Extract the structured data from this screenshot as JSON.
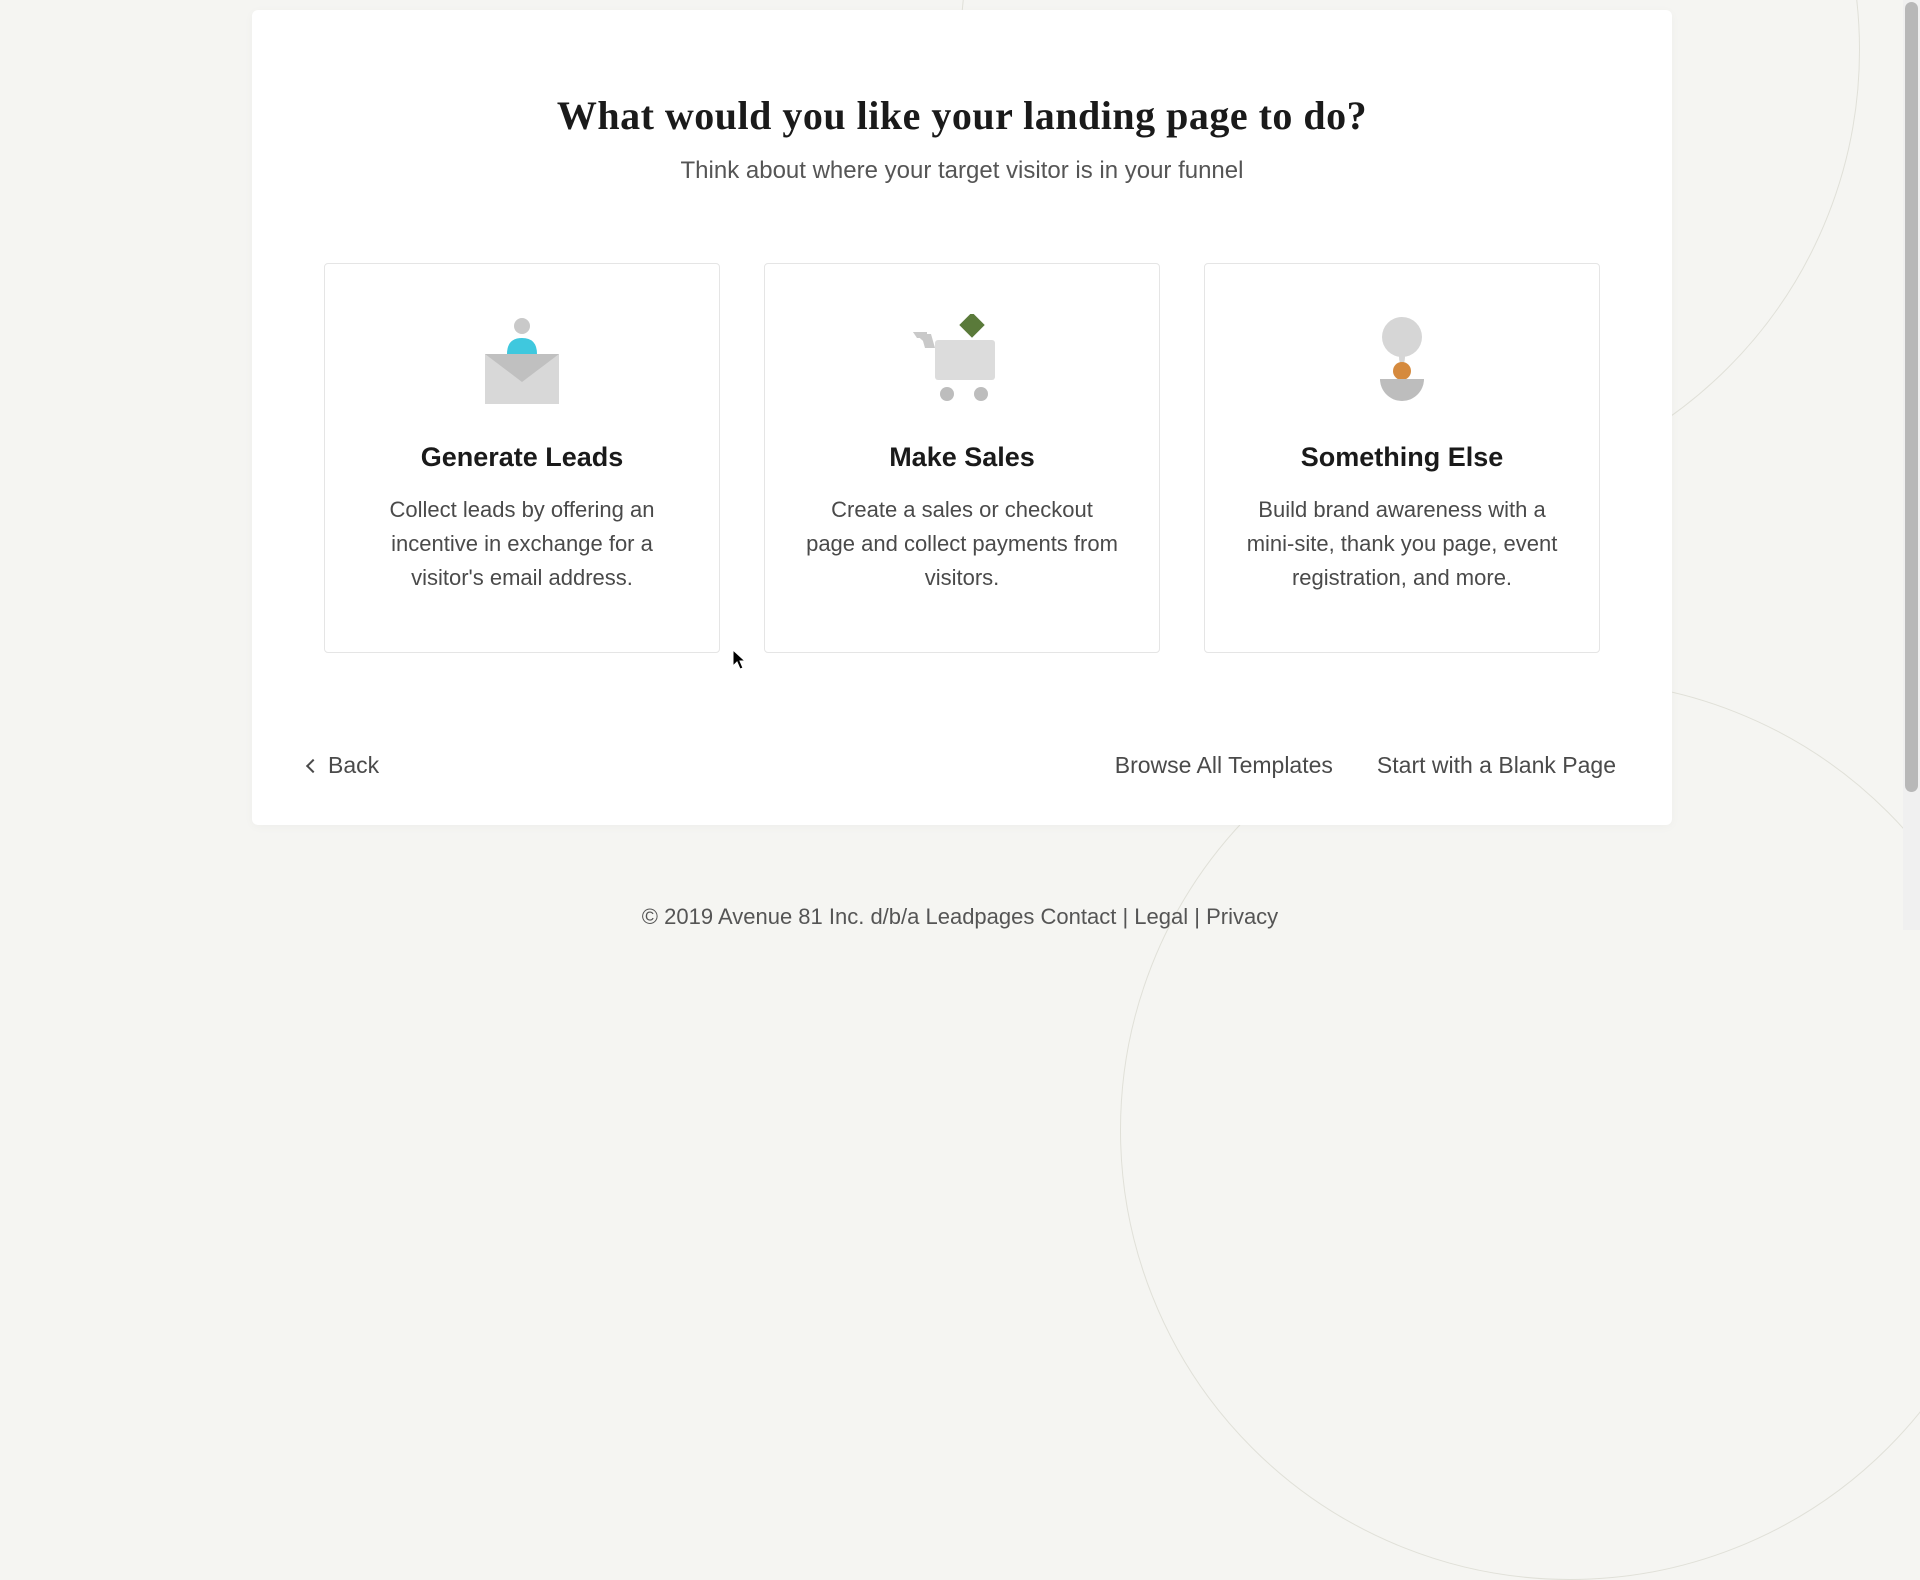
{
  "header": {
    "heading": "What would you like your landing page to do?",
    "subheading": "Think about where your target visitor is in your funnel"
  },
  "cards": [
    {
      "title": "Generate Leads",
      "description": "Collect leads by offering an incentive in exchange for a visitor's email address."
    },
    {
      "title": "Make Sales",
      "description": "Create a sales or checkout page and collect payments from visitors."
    },
    {
      "title": "Something Else",
      "description": "Build brand awareness with a mini-site, thank you page, event registration, and more."
    }
  ],
  "footer": {
    "back": "Back",
    "browse": "Browse All Templates",
    "blank": "Start with a Blank Page"
  },
  "pageFooter": {
    "copyright": "© 2019 Avenue 81 Inc. d/b/a Leadpages ",
    "contact": "Contact",
    "sep1": " | ",
    "legal": "Legal",
    "sep2": " | ",
    "privacy": "Privacy"
  }
}
